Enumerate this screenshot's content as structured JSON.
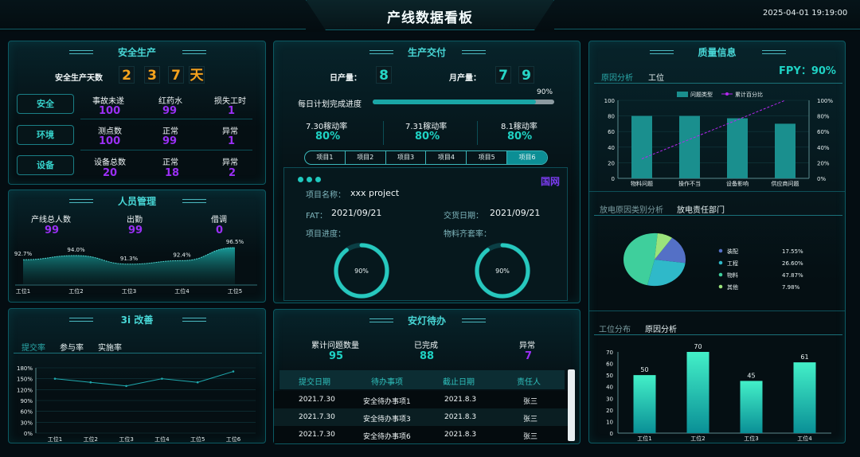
{
  "header": {
    "title": "产线数据看板",
    "datetime": "2025-04-01 19:19:00"
  },
  "safety": {
    "title": "安全生产",
    "days_label": "安全生产天数",
    "days_digits": [
      "2",
      "3",
      "7",
      "天"
    ],
    "rows": [
      {
        "button": "安全",
        "cols": [
          {
            "label": "事故未遂",
            "value": "100"
          },
          {
            "label": "红药水",
            "value": "99"
          },
          {
            "label": "损失工时",
            "value": "1"
          }
        ]
      },
      {
        "button": "环境",
        "cols": [
          {
            "label": "测点数",
            "value": "100"
          },
          {
            "label": "正常",
            "value": "99"
          },
          {
            "label": "异常",
            "value": "1"
          }
        ]
      },
      {
        "button": "设备",
        "cols": [
          {
            "label": "设备总数",
            "value": "20"
          },
          {
            "label": "正常",
            "value": "18"
          },
          {
            "label": "异常",
            "value": "2"
          }
        ]
      }
    ]
  },
  "personnel": {
    "title": "人员管理",
    "stats": [
      {
        "label": "产线总人数",
        "value": "99"
      },
      {
        "label": "出勤",
        "value": "99"
      },
      {
        "label": "借调",
        "value": "0"
      }
    ]
  },
  "improve": {
    "title": "3i 改善",
    "tabs": [
      "提交率",
      "参与率",
      "实施率"
    ]
  },
  "delivery": {
    "title": "生产交付",
    "daily_label": "日产量：",
    "daily_digits": [
      "8"
    ],
    "monthly_label": "月产量：",
    "monthly_digits": [
      "7",
      "9"
    ],
    "plan_label": "每日计划完成进度",
    "plan_pct": "90%",
    "plan_value": 0.9,
    "rates": [
      {
        "label": "7.30稼动率",
        "value": "80%"
      },
      {
        "label": "7.31稼动率",
        "value": "80%"
      },
      {
        "label": "8.1稼动率",
        "value": "80%"
      }
    ],
    "project_tabs": [
      "项目1",
      "项目2",
      "项目3",
      "项目4",
      "项目5",
      "项目6"
    ],
    "project": {
      "brand": "国网",
      "name_label": "项目名称：",
      "name": "xxx project",
      "fat_label": "FAT：",
      "fat": "2021/09/21",
      "delivery_label": "交货日期：",
      "delivery": "2021/09/21",
      "progress_label": "项目进度：",
      "material_label": "物料齐套率：",
      "progress_pct": "90%",
      "progress_value": 0.9,
      "material_pct": "90%",
      "material_value": 0.9
    }
  },
  "andon": {
    "title": "安灯待办",
    "stats": [
      {
        "label": "累计问题数量",
        "value": "95"
      },
      {
        "label": "已完成",
        "value": "88"
      },
      {
        "label": "异常",
        "value": "7"
      }
    ],
    "headers": [
      "提交日期",
      "待办事项",
      "截止日期",
      "责任人"
    ],
    "rows": [
      [
        "2021.7.30",
        "安全待办事项1",
        "2021.8.3",
        "张三"
      ],
      [
        "2021.7.30",
        "安全待办事项3",
        "2021.8.3",
        "张三"
      ],
      [
        "2021.7.30",
        "安全待办事项6",
        "2021.8.3",
        "张三"
      ]
    ]
  },
  "quality": {
    "title": "质量信息",
    "fpy": "FPY：90%",
    "tabs": [
      "原因分析",
      "工位"
    ],
    "tabs2": [
      "放电原因类别分析",
      "放电责任部门"
    ],
    "tabs3": [
      "工位分布",
      "原因分析"
    ]
  },
  "colors": {
    "teal": "#1fd2c4",
    "purple": "#9a2ff5",
    "orange": "#f5a21d",
    "bar": "#1a8f8e"
  },
  "chart_data": [
    {
      "type": "area",
      "name": "personnel",
      "categories": [
        "工位1",
        "工位2",
        "工位3",
        "工位4",
        "工位5"
      ],
      "values": [
        92.7,
        94.0,
        91.3,
        92.4,
        96.5
      ],
      "labels": [
        "92.7%",
        "94.0%",
        "91.3%",
        "92.4%",
        "96.5%"
      ],
      "ylim": [
        85,
        98
      ]
    },
    {
      "type": "line",
      "name": "improve",
      "categories": [
        "工位1",
        "工位2",
        "工位3",
        "工位4",
        "工位5",
        "工位6"
      ],
      "values": [
        150,
        140,
        130,
        150,
        140,
        170
      ],
      "yticks": [
        "0%",
        "30%",
        "60%",
        "90%",
        "120%",
        "150%",
        "180%"
      ],
      "ylim": [
        0,
        180
      ]
    },
    {
      "type": "bar",
      "name": "quality_pareto",
      "categories": [
        "物料问题",
        "操作不当",
        "设备影响",
        "供应商问题"
      ],
      "values": [
        80,
        80,
        77,
        70
      ],
      "line": [
        25,
        50,
        75,
        100
      ],
      "legend": [
        "问题类型",
        "累计百分比"
      ],
      "ylim": [
        0,
        100
      ],
      "yticks": [
        "0",
        "20",
        "40",
        "60",
        "80",
        "100"
      ],
      "y2ticks": [
        "0%",
        "20%",
        "40%",
        "60%",
        "80%",
        "100%"
      ]
    },
    {
      "type": "pie",
      "name": "discharge",
      "labels": [
        "装配",
        "工程",
        "物料",
        "其他"
      ],
      "pct": [
        "17.55%",
        "26.60%",
        "47.87%",
        "7.98%"
      ],
      "values": [
        17.55,
        26.6,
        47.87,
        7.98
      ],
      "colors": [
        "#5470c6",
        "#2fb9c9",
        "#3fcf9c",
        "#9be37b"
      ]
    },
    {
      "type": "bar",
      "name": "station",
      "categories": [
        "工位1",
        "工位2",
        "工位3",
        "工位4"
      ],
      "values": [
        50,
        70,
        45,
        61
      ],
      "labels": [
        "50",
        "70",
        "45",
        "61"
      ],
      "ylim": [
        0,
        70
      ],
      "yticks": [
        "0",
        "10",
        "20",
        "30",
        "40",
        "50",
        "60",
        "70"
      ]
    }
  ]
}
